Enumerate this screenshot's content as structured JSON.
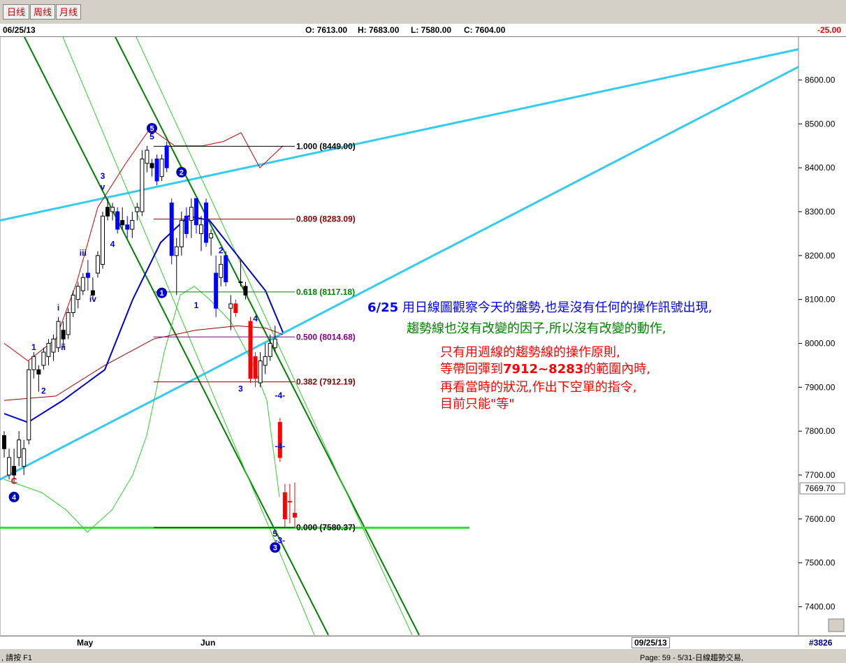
{
  "tabs": [
    "日线",
    "周线",
    "月线"
  ],
  "info": {
    "date": "06/25/13",
    "open": "O: 7613.00",
    "high": "H: 7683.00",
    "low": "L: 7580.00",
    "close": "C: 7604.00",
    "change": "-25.00"
  },
  "bottom": {
    "month1": "May",
    "month2": "Jun",
    "date_box": "09/25/13",
    "id": "#3826"
  },
  "status": {
    "left": ", 請按 F1",
    "right": "Page: 59 - 5/31-日線趨勢交易,"
  },
  "annotations": {
    "line1_date": "6/25",
    "line1_text": " 用日線圖觀察今天的盤勢,也是沒有任何的操作訊號出現,",
    "line2": "趨勢線也沒有改變的因子,所以沒有改變的動作,",
    "line3": "只有用週線的趨勢線的操作原則,",
    "line4_a": "等帶回彈到",
    "line4_b": "7912~8283",
    "line4_c": "的範圍內時,",
    "line5": "再看當時的狀況,作出下空單的指令,",
    "line6": "目前只能\"等\""
  },
  "colors": {
    "up": "#ffffff",
    "down_blue": "#0000ff",
    "down_red": "#ff0000",
    "fib": "#800000",
    "cyan": "#33ccee",
    "green": "#008000",
    "lightgreen": "#33cc33",
    "bbred": "#cc0000",
    "ma_blue": "#0000cc"
  },
  "chart_data": {
    "type": "candlestick",
    "ylim": [
      7350,
      8650
    ],
    "y_ticks": [
      7400,
      7500,
      7600,
      7700,
      7800,
      7900,
      8000,
      8100,
      8200,
      8300,
      8400,
      8500,
      8600
    ],
    "y_tick_labels": [
      "7400.00",
      "7500.00",
      "7600.00",
      "7700.00",
      "7800.00",
      "7900.00",
      "8000.00",
      "8100.00",
      "8200.00",
      "8300.00",
      "8400.00",
      "8500.00",
      "8600.00"
    ],
    "last_price_label": "7669.70",
    "last_price": 7669.7,
    "fib_levels": [
      {
        "label": "1.000 (8449.00)",
        "value": 8449.0
      },
      {
        "label": "0.809 (8283.09)",
        "value": 8283.09
      },
      {
        "label": "0.618 (8117.18)",
        "value": 8117.18
      },
      {
        "label": "0.500 (8014.68)",
        "value": 8014.68
      },
      {
        "label": "0.382 (7912.19)",
        "value": 7912.19
      },
      {
        "label": "0.000 (7580.37)",
        "value": 7580.37
      }
    ],
    "candles": [
      {
        "o": 7790,
        "h": 7800,
        "l": 7740,
        "c": 7760,
        "col": "black"
      },
      {
        "o": 7700,
        "h": 7760,
        "l": 7690,
        "c": 7740,
        "col": "white"
      },
      {
        "o": 7720,
        "h": 7760,
        "l": 7680,
        "c": 7700,
        "col": "black"
      },
      {
        "o": 7740,
        "h": 7800,
        "l": 7720,
        "c": 7780,
        "col": "white"
      },
      {
        "o": 7720,
        "h": 7780,
        "l": 7700,
        "c": 7760,
        "col": "white"
      },
      {
        "o": 7780,
        "h": 7960,
        "l": 7770,
        "c": 7940,
        "col": "white"
      },
      {
        "o": 7940,
        "h": 7980,
        "l": 7920,
        "c": 7970,
        "col": "white"
      },
      {
        "o": 7940,
        "h": 7950,
        "l": 7890,
        "c": 7930,
        "col": "black"
      },
      {
        "o": 7950,
        "h": 7990,
        "l": 7940,
        "c": 7980,
        "col": "white"
      },
      {
        "o": 7970,
        "h": 8010,
        "l": 7950,
        "c": 8000,
        "col": "white"
      },
      {
        "o": 7980,
        "h": 8020,
        "l": 7960,
        "c": 8010,
        "col": "white"
      },
      {
        "o": 7990,
        "h": 8060,
        "l": 7980,
        "c": 8050,
        "col": "white"
      },
      {
        "o": 8010,
        "h": 8050,
        "l": 7990,
        "c": 8030,
        "col": "black"
      },
      {
        "o": 8020,
        "h": 8080,
        "l": 8010,
        "c": 8070,
        "col": "white"
      },
      {
        "o": 8070,
        "h": 8120,
        "l": 8060,
        "c": 8110,
        "col": "white"
      },
      {
        "o": 8100,
        "h": 8140,
        "l": 8080,
        "c": 8130,
        "col": "white"
      },
      {
        "o": 8120,
        "h": 8160,
        "l": 8110,
        "c": 8150,
        "col": "white"
      },
      {
        "o": 8150,
        "h": 8190,
        "l": 8120,
        "c": 8160,
        "col": "blue"
      },
      {
        "o": 8120,
        "h": 8150,
        "l": 8100,
        "c": 8110,
        "col": "black"
      },
      {
        "o": 8160,
        "h": 8210,
        "l": 8150,
        "c": 8200,
        "col": "white"
      },
      {
        "o": 8180,
        "h": 8300,
        "l": 8170,
        "c": 8290,
        "col": "white"
      },
      {
        "o": 8310,
        "h": 8330,
        "l": 8280,
        "c": 8290,
        "col": "black"
      },
      {
        "o": 8300,
        "h": 8320,
        "l": 8280,
        "c": 8310,
        "col": "white"
      },
      {
        "o": 8300,
        "h": 8310,
        "l": 8250,
        "c": 8260,
        "col": "blue"
      },
      {
        "o": 8280,
        "h": 8310,
        "l": 8260,
        "c": 8270,
        "col": "black"
      },
      {
        "o": 8270,
        "h": 8290,
        "l": 8240,
        "c": 8260,
        "col": "blue"
      },
      {
        "o": 8280,
        "h": 8300,
        "l": 8240,
        "c": 8260,
        "col": "white"
      },
      {
        "o": 8300,
        "h": 8320,
        "l": 8280,
        "c": 8310,
        "col": "white"
      },
      {
        "o": 8300,
        "h": 8440,
        "l": 8290,
        "c": 8420,
        "col": "white"
      },
      {
        "o": 8410,
        "h": 8450,
        "l": 8390,
        "c": 8440,
        "col": "white"
      },
      {
        "o": 8400,
        "h": 8420,
        "l": 8380,
        "c": 8410,
        "col": "black"
      },
      {
        "o": 8420,
        "h": 8430,
        "l": 8360,
        "c": 8370,
        "col": "blue"
      },
      {
        "o": 8380,
        "h": 8430,
        "l": 8370,
        "c": 8420,
        "col": "white"
      },
      {
        "o": 8450,
        "h": 8460,
        "l": 8390,
        "c": 8400,
        "col": "blue"
      },
      {
        "o": 8320,
        "h": 8330,
        "l": 8180,
        "c": 8200,
        "col": "blue"
      },
      {
        "o": 8200,
        "h": 8240,
        "l": 8110,
        "c": 8220,
        "col": "white"
      },
      {
        "o": 8220,
        "h": 8300,
        "l": 8200,
        "c": 8280,
        "col": "white"
      },
      {
        "o": 8290,
        "h": 8310,
        "l": 8240,
        "c": 8250,
        "col": "blue"
      },
      {
        "o": 8280,
        "h": 8330,
        "l": 8240,
        "c": 8310,
        "col": "white"
      },
      {
        "o": 8330,
        "h": 8330,
        "l": 8250,
        "c": 8270,
        "col": "blue"
      },
      {
        "o": 8250,
        "h": 8290,
        "l": 8210,
        "c": 8270,
        "col": "white"
      },
      {
        "o": 8320,
        "h": 8330,
        "l": 8220,
        "c": 8230,
        "col": "blue"
      },
      {
        "o": 8240,
        "h": 8260,
        "l": 8200,
        "c": 8250,
        "col": "white"
      },
      {
        "o": 8160,
        "h": 8200,
        "l": 8060,
        "c": 8080,
        "col": "blue"
      },
      {
        "o": 8150,
        "h": 8200,
        "l": 8130,
        "c": 8180,
        "col": "white"
      },
      {
        "o": 8200,
        "h": 8210,
        "l": 8130,
        "c": 8140,
        "col": "blue"
      },
      {
        "o": 8080,
        "h": 8110,
        "l": 8030,
        "c": 8090,
        "col": "white"
      },
      {
        "o": 8090,
        "h": 8100,
        "l": 8060,
        "c": 8070,
        "col": "red"
      },
      {
        "o": 8140,
        "h": 8190,
        "l": 8130,
        "c": 8140,
        "col": "white"
      },
      {
        "o": 8130,
        "h": 8140,
        "l": 8100,
        "c": 8110,
        "col": "black"
      },
      {
        "o": 8050,
        "h": 8060,
        "l": 7910,
        "c": 7920,
        "col": "red"
      },
      {
        "o": 7970,
        "h": 7980,
        "l": 7900,
        "c": 7920,
        "col": "red"
      },
      {
        "o": 7910,
        "h": 7980,
        "l": 7900,
        "c": 7960,
        "col": "white"
      },
      {
        "o": 7950,
        "h": 8000,
        "l": 7930,
        "c": 7970,
        "col": "white"
      },
      {
        "o": 7970,
        "h": 8020,
        "l": 7960,
        "c": 8000,
        "col": "white"
      },
      {
        "o": 7990,
        "h": 8040,
        "l": 7980,
        "c": 8010,
        "col": "white"
      },
      {
        "o": 7820,
        "h": 7830,
        "l": 7730,
        "c": 7740,
        "col": "red"
      },
      {
        "o": 7660,
        "h": 7680,
        "l": 7580,
        "c": 7600,
        "col": "red"
      },
      {
        "o": 7640,
        "h": 7680,
        "l": 7590,
        "c": 7640,
        "col": "red"
      },
      {
        "o": 7613,
        "h": 7683,
        "l": 7580,
        "c": 7604,
        "col": "red"
      }
    ],
    "wave_labels": [
      {
        "t": "1",
        "i": 6,
        "v": 7985,
        "c": "#0000cc"
      },
      {
        "t": "2",
        "i": 8,
        "v": 7885,
        "c": "#0000cc"
      },
      {
        "t": "i",
        "i": 11,
        "v": 8075,
        "c": "#0000cc"
      },
      {
        "t": "ii",
        "i": 12,
        "v": 7985,
        "c": "#0000cc"
      },
      {
        "t": "iii",
        "i": 16,
        "v": 8200,
        "c": "#0000cc"
      },
      {
        "t": "iv",
        "i": 18,
        "v": 8095,
        "c": "#0000cc"
      },
      {
        "t": "3",
        "i": 20,
        "v": 8375,
        "c": "#0000cc"
      },
      {
        "t": "v",
        "i": 20,
        "v": 8350,
        "c": "#0000cc"
      },
      {
        "t": "4",
        "i": 22,
        "v": 8220,
        "c": "#0000cc"
      },
      {
        "t": "5",
        "i": 30,
        "v": 8465,
        "c": "#0000cc"
      },
      {
        "t": "1",
        "i": 39,
        "v": 8080,
        "c": "#0000cc"
      },
      {
        "t": "2",
        "i": 44,
        "v": 8205,
        "c": "#0000cc"
      },
      {
        "t": "3",
        "i": 48,
        "v": 7890,
        "c": "#0000cc"
      },
      {
        "t": "4",
        "i": 51,
        "v": 8050,
        "c": "#0000cc"
      },
      {
        "t": "-4-",
        "i": 56,
        "v": 7875,
        "c": "#0000cc"
      },
      {
        "t": "-4-",
        "i": 56,
        "v": 7760,
        "c": "#0000cc"
      },
      {
        "t": "5",
        "i": 55,
        "v": 7560,
        "c": "#0000cc"
      },
      {
        "t": "-3-",
        "i": 56,
        "v": 7545,
        "c": "#0000cc"
      },
      {
        "t": "C",
        "i": 2,
        "v": 7680,
        "c": "#cc0000"
      }
    ],
    "circle_labels": [
      {
        "t": "4",
        "i": 2,
        "v": 7650
      },
      {
        "t": "5",
        "i": 30,
        "v": 8490
      },
      {
        "t": "2",
        "i": 36,
        "v": 8390
      },
      {
        "t": "1",
        "i": 32,
        "v": 8115
      },
      {
        "t": "3",
        "i": 55,
        "v": 7535
      }
    ]
  }
}
